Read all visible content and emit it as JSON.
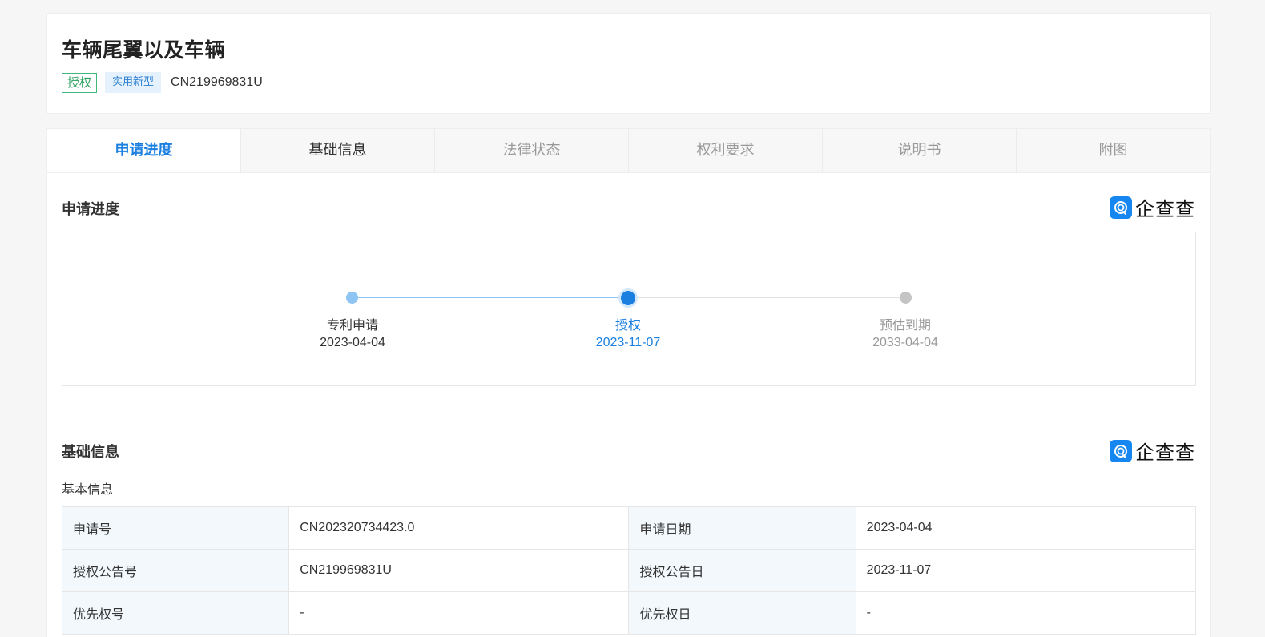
{
  "header": {
    "title": "车辆尾翼以及车辆",
    "status_tag": "授权",
    "type_tag": "实用新型",
    "patent_number": "CN219969831U"
  },
  "tabs": [
    {
      "label": "申请进度"
    },
    {
      "label": "基础信息"
    },
    {
      "label": "法律状态"
    },
    {
      "label": "权利要求"
    },
    {
      "label": "说明书"
    },
    {
      "label": "附图"
    }
  ],
  "brand": {
    "name": "企查查",
    "icon": "qichacha-logo-icon",
    "color": "#1686f0"
  },
  "progress": {
    "title": "申请进度",
    "steps": [
      {
        "label": "专利申请",
        "date": "2023-04-04"
      },
      {
        "label": "授权",
        "date": "2023-11-07"
      },
      {
        "label": "预估到期",
        "date": "2033-04-04"
      }
    ]
  },
  "basic": {
    "title": "基础信息",
    "subtitle": "基本信息",
    "rows": [
      {
        "k1": "申请号",
        "v1": "CN202320734423.0",
        "k2": "申请日期",
        "v2": "2023-04-04"
      },
      {
        "k1": "授权公告号",
        "v1": "CN219969831U",
        "k2": "授权公告日",
        "v2": "2023-11-07"
      },
      {
        "k1": "优先权号",
        "v1": "-",
        "k2": "优先权日",
        "v2": "-"
      }
    ]
  },
  "colors": {
    "accent": "#1b7fe0",
    "green": "#2aa05e",
    "muted": "#999999"
  }
}
